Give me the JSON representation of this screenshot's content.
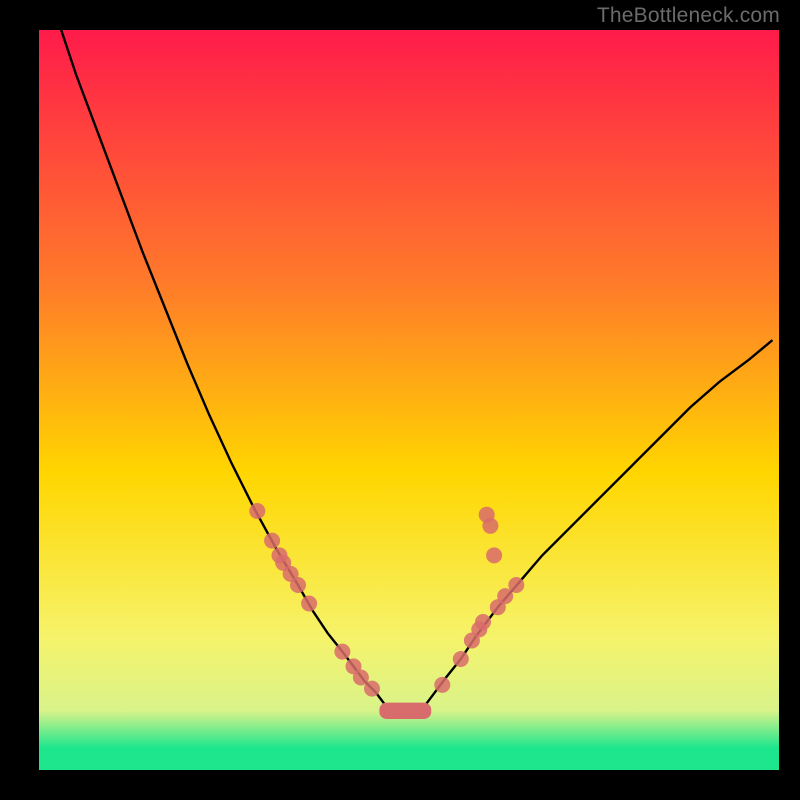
{
  "watermark": "TheBottleneck.com",
  "colors": {
    "top": "#ff1b4a",
    "mid_upper": "#ff7a2a",
    "mid": "#ffd600",
    "mid_lower": "#f6f36a",
    "low_band": "#d9f38a",
    "bottom_band": "#1ee68d",
    "curve_stroke": "#000000",
    "marker_fill": "#d86b6b",
    "marker_stroke": "#d86b6b",
    "plateau_fill": "#d86b6b"
  },
  "chart_data": {
    "type": "line",
    "title": "",
    "xlabel": "",
    "ylabel": "",
    "xlim": [
      0,
      100
    ],
    "ylim": [
      0,
      100
    ],
    "x": [
      3,
      5,
      8,
      11,
      14,
      17,
      20,
      23,
      26,
      29,
      32,
      35,
      37,
      39,
      41,
      42.5,
      44,
      45.5,
      47,
      52,
      53.5,
      55,
      57,
      59,
      62,
      65,
      68,
      72,
      76,
      80,
      84,
      88,
      92,
      96,
      99
    ],
    "y": [
      100,
      94,
      86,
      78,
      70,
      62.5,
      55,
      48,
      41.5,
      35.5,
      30,
      25,
      21.5,
      18.5,
      16,
      14,
      12,
      10.5,
      8.5,
      8.5,
      10.5,
      12.5,
      15,
      18,
      22,
      25.5,
      29,
      33,
      37,
      41,
      45,
      49,
      52.5,
      55.5,
      58
    ],
    "markers_left": [
      {
        "x": 29.5,
        "y": 35
      },
      {
        "x": 31.5,
        "y": 31
      },
      {
        "x": 32.5,
        "y": 29
      },
      {
        "x": 33.0,
        "y": 28
      },
      {
        "x": 34.0,
        "y": 26.5
      },
      {
        "x": 35.0,
        "y": 25
      },
      {
        "x": 36.5,
        "y": 22.5
      },
      {
        "x": 41.0,
        "y": 16
      },
      {
        "x": 42.5,
        "y": 14
      },
      {
        "x": 43.5,
        "y": 12.5
      },
      {
        "x": 45.0,
        "y": 11
      }
    ],
    "markers_right": [
      {
        "x": 54.5,
        "y": 11.5
      },
      {
        "x": 57.0,
        "y": 15
      },
      {
        "x": 58.5,
        "y": 17.5
      },
      {
        "x": 59.5,
        "y": 19
      },
      {
        "x": 60.0,
        "y": 20
      },
      {
        "x": 62.0,
        "y": 22
      },
      {
        "x": 63.0,
        "y": 23.5
      },
      {
        "x": 64.5,
        "y": 25
      },
      {
        "x": 60.5,
        "y": 34.5
      },
      {
        "x": 61.0,
        "y": 33
      },
      {
        "x": 61.5,
        "y": 29
      }
    ],
    "plateau": {
      "x0": 46,
      "x1": 53,
      "y": 8.0,
      "thickness": 2.2
    }
  }
}
